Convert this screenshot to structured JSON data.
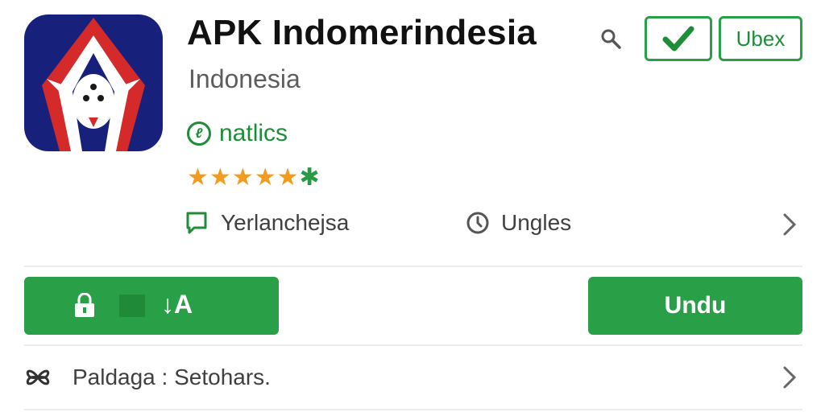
{
  "app": {
    "title": "APK Indomerindesia",
    "subtitle": "Indonesia",
    "publisher": "natlics",
    "rating": 5,
    "icon": "app-logo-icon"
  },
  "header_actions": {
    "search_icon": "search-icon",
    "check_icon": "check-icon",
    "ubex_label": "Ubex"
  },
  "info_row": {
    "left_label": "Yerlanchejsa",
    "left_icon": "comment-icon",
    "right_label": "Ungles",
    "right_icon": "clock-icon",
    "chevron": "chevron-right-icon"
  },
  "buttons": {
    "install_label": "↓A",
    "install_icon": "lock-icon",
    "undu_label": "Undu"
  },
  "bottom_row": {
    "label": "Paldaga : Setohars.",
    "icon": "bow-icon",
    "chevron": "chevron-right-icon"
  },
  "colors": {
    "accent_green": "#29a047",
    "publisher_green": "#1e8d3a",
    "star_orange": "#f29b1c",
    "icon_navy": "#17207a",
    "icon_red": "#d42a2a"
  }
}
